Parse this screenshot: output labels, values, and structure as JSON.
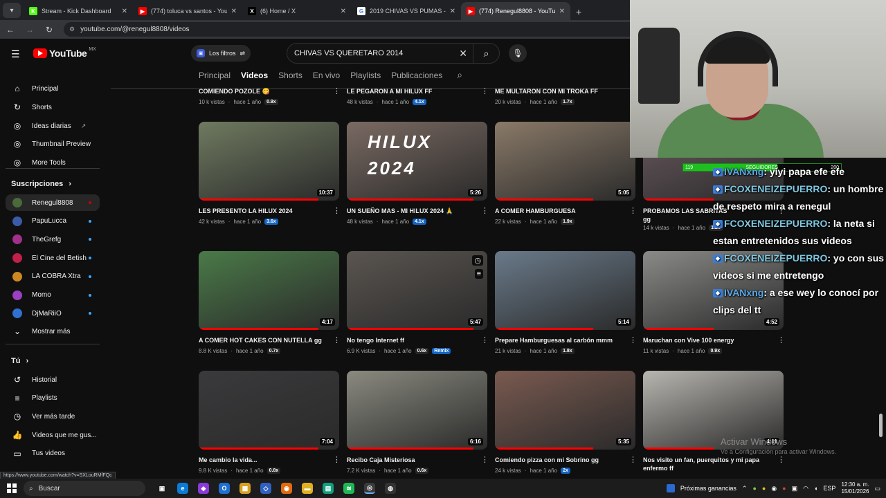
{
  "browser": {
    "tabs": [
      {
        "title": "Stream - Kick Dashboard",
        "icon": "kick-icon",
        "color": "#53fc18",
        "glyph": "K"
      },
      {
        "title": "(774) toluca vs santos - YouTub",
        "icon": "youtube-icon",
        "color": "#ff0000",
        "glyph": "▶"
      },
      {
        "title": "(6) Home / X",
        "icon": "x-icon",
        "color": "#000000",
        "glyph": "X"
      },
      {
        "title": "2019 CHIVAS VS PUMAS - Busc",
        "icon": "google-icon",
        "color": "#ffffff",
        "glyph": "G"
      },
      {
        "title": "(774) Renegul8808 - YouTube",
        "icon": "youtube-icon",
        "color": "#ff0000",
        "glyph": "▶"
      }
    ],
    "url": "youtube.com/@renegul8808/videos",
    "status_url": "https://www.youtube.com/watch?v=SXLouRMfFQc"
  },
  "youtube": {
    "logo": "YouTube",
    "region": "MX",
    "filters_label": "Los filtros",
    "search_value": "CHIVAS VS QUERETARO 2014",
    "channel_tabs": [
      "Principal",
      "Videos",
      "Shorts",
      "En vivo",
      "Playlists",
      "Publicaciones"
    ],
    "guide_main": [
      {
        "label": "Principal",
        "icon": "home-icon",
        "glyph": "⌂"
      },
      {
        "label": "Shorts",
        "icon": "shorts-icon",
        "glyph": "↻"
      },
      {
        "label": "Ideas diarias",
        "icon": "ideas-icon",
        "glyph": "◎"
      },
      {
        "label": "Thumbnail Preview",
        "icon": "thumbnail-icon",
        "glyph": "◎"
      },
      {
        "label": "More Tools",
        "icon": "tools-icon",
        "glyph": "◎"
      }
    ],
    "subs_title": "Suscripciones",
    "subscriptions": [
      {
        "label": "Renegul8808",
        "color": "#4a6a3a"
      },
      {
        "label": "PapuLucca",
        "color": "#3b5ba8"
      },
      {
        "label": "TheGrefg",
        "color": "#a0308a"
      },
      {
        "label": "El Cine del Betish",
        "color": "#c0204a"
      },
      {
        "label": "LA COBRA Xtra",
        "color": "#cc8822"
      },
      {
        "label": "Momo",
        "color": "#9a40c0"
      },
      {
        "label": "DjMaRiiO",
        "color": "#3070d0"
      }
    ],
    "show_more": "Mostrar más",
    "you_title": "Tú",
    "you_items": [
      {
        "label": "Historial",
        "icon": "history-icon",
        "glyph": "↺"
      },
      {
        "label": "Playlists",
        "icon": "playlists-icon",
        "glyph": "≡"
      },
      {
        "label": "Ver más tarde",
        "icon": "watch-later-icon",
        "glyph": "◷"
      },
      {
        "label": "Videos que me gus...",
        "icon": "like-icon",
        "glyph": "👍"
      },
      {
        "label": "Tus videos",
        "icon": "your-videos-icon",
        "glyph": "▭"
      }
    ]
  },
  "videos_row0": [
    {
      "title": "COMIENDO POZOLE 😋",
      "views": "10 k vistas",
      "age": "hace 1 año",
      "chip": "0.9x",
      "blue": false
    },
    {
      "title": "LE PEGARON A MI HILUX FF",
      "views": "48 k vistas",
      "age": "hace 1 año",
      "chip": "4.1x",
      "blue": true
    },
    {
      "title": "ME MULTARON CON MI TROKA FF",
      "views": "20 k vistas",
      "age": "hace 1 año",
      "chip": "1.7x",
      "blue": false
    }
  ],
  "videos_row1": [
    {
      "title": "LES PRESENTO LA HILUX 2024",
      "views": "42 k vistas",
      "age": "hace 1 año",
      "chip": "3.6x",
      "blue": true,
      "duration": "10:37",
      "thumb": "#6f7a60"
    },
    {
      "title": "UN SUEÑO MAS - MI HILUX 2024 🙏",
      "views": "48 k vistas",
      "age": "hace 1 año",
      "chip": "4.1x",
      "blue": true,
      "duration": "5:26",
      "thumb": "#7a6a62",
      "overlay": "HILUX 2024"
    },
    {
      "title": "A COMER HAMBURGUESA",
      "views": "22 k vistas",
      "age": "hace 1 año",
      "chip": "1.9x",
      "blue": false,
      "duration": "5:05",
      "thumb": "#8a7a68"
    },
    {
      "title": "PROBAMOS LAS SABRITAS",
      "title2": "gg",
      "views": "14 k vistas",
      "age": "hace 1 año",
      "chip": "1.2x",
      "blue": false,
      "duration": "",
      "thumb": "#6a5a60"
    }
  ],
  "videos_row2": [
    {
      "title": "A COMER HOT CAKES CON NUTELLA gg",
      "views": "8.8 K vistas",
      "age": "hace 1 año",
      "chip": "0.7x",
      "blue": false,
      "duration": "4:17",
      "thumb": "#4a7a48"
    },
    {
      "title": "No tengo Internet ff",
      "views": "6.9 K vistas",
      "age": "hace 1 año",
      "chip": "0.6x",
      "blue": false,
      "remix": "Remix",
      "duration": "5:47",
      "thumb": "#5a5550"
    },
    {
      "title": "Prepare Hamburguesas al carbón mmm",
      "views": "21 k vistas",
      "age": "hace 1 año",
      "chip": "1.8x",
      "blue": false,
      "duration": "5:14",
      "thumb": "#6a7a8a"
    },
    {
      "title": "Maruchan con Vive 100 energy",
      "views": "11 k vistas",
      "age": "hace 1 año",
      "chip": "0.9x",
      "blue": false,
      "duration": "4:52",
      "thumb": "#8a8a88"
    }
  ],
  "videos_row3": [
    {
      "title": "Me cambio la vida...",
      "views": "9.8 K vistas",
      "age": "hace 1 año",
      "chip": "0.8x",
      "blue": false,
      "duration": "7:04",
      "thumb": "#3a3a3c"
    },
    {
      "title": "Recibo Caja Misteriosa",
      "views": "7.2 K vistas",
      "age": "hace 1 año",
      "chip": "0.6x",
      "blue": false,
      "duration": "6:16",
      "thumb": "#8a8a80"
    },
    {
      "title": "Comiendo pizza con mi Sobrino gg",
      "views": "24 k vistas",
      "age": "hace 1 año",
      "chip": "2x",
      "blue": true,
      "duration": "5:35",
      "thumb": "#7a5a50"
    },
    {
      "title": "Nos visito un fan, puerquitos y mi papa",
      "title2": "enfermo ff",
      "views": "",
      "age": "",
      "chip": "",
      "blue": false,
      "duration": "4:11",
      "thumb": "#b8b6b0"
    }
  ],
  "stream_overlay": {
    "followers_label": "SEGUIDORES",
    "followers_current": "119",
    "followers_goal": "200",
    "followers_progress": 0.595,
    "chat": [
      {
        "user": "IVANxng",
        "message": ": yiyi papa efe efe"
      },
      {
        "user": "FCOXENEIZEPUERRO",
        "message": ": un hombre de respeto mira a renegul"
      },
      {
        "user": "FCOXENEIZEPUERRO",
        "message": ": la neta si estan entretenidos sus videos"
      },
      {
        "user": "FCOXENEIZEPUERRO",
        "message": ": yo con sus videos si me entretengo"
      },
      {
        "user": "IVANxng",
        "message": ": a ese wey lo conocí por clips del tt"
      }
    ]
  },
  "windows": {
    "activate_title": "Activar Windows",
    "activate_sub": "Ve a Configuración para activar Windows.",
    "search": "Buscar",
    "weather": "Próximas ganancias",
    "lang": "ESP",
    "time": "12:30 a. m.",
    "date": "15/01/2026"
  }
}
